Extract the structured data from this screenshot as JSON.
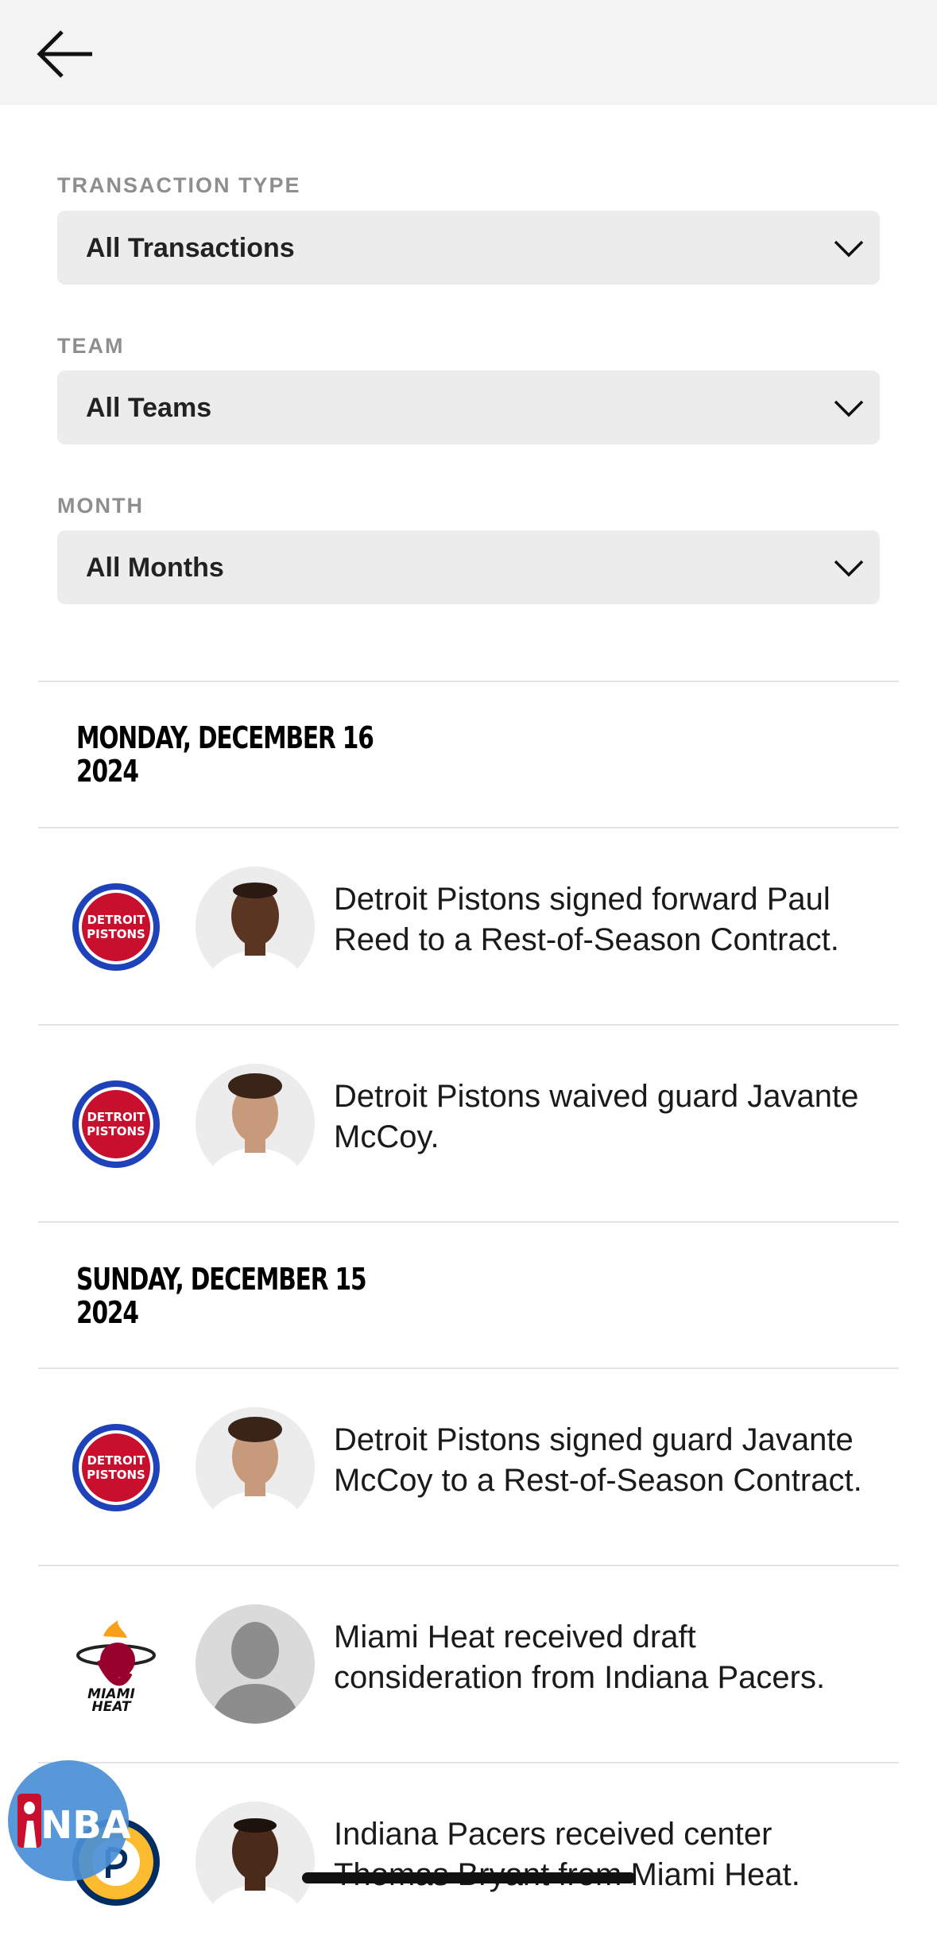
{
  "filters": [
    {
      "label": "TRANSACTION TYPE",
      "value": "All Transactions"
    },
    {
      "label": "TEAM",
      "value": "All Teams"
    },
    {
      "label": "MONTH",
      "value": "All Months"
    }
  ],
  "groups": [
    {
      "date_line1": "MONDAY, DECEMBER 16",
      "date_line2": "2024",
      "items": [
        {
          "team": "Detroit Pistons",
          "logo_text": "DETROIT PISTONS",
          "text": "Detroit Pistons signed forward Paul Reed to a Rest-of-Season Contract."
        },
        {
          "team": "Detroit Pistons",
          "logo_text": "DETROIT PISTONS",
          "text": "Detroit Pistons waived guard Javante McCoy."
        }
      ]
    },
    {
      "date_line1": "SUNDAY, DECEMBER 15",
      "date_line2": "2024",
      "items": [
        {
          "team": "Detroit Pistons",
          "logo_text": "DETROIT PISTONS",
          "text": "Detroit Pistons signed guard Javante McCoy to a Rest-of-Season Contract."
        },
        {
          "team": "Miami Heat",
          "logo_text": "MIAMI HEAT",
          "text": "Miami Heat received draft consideration from Indiana Pacers."
        },
        {
          "team": "Indiana Pacers",
          "logo_text": "PACERS",
          "text": "Indiana Pacers received center Thomas Bryant from Miami Heat."
        }
      ]
    }
  ],
  "fab": {
    "label": "NBA"
  },
  "colors": {
    "pistons_blue": "#1d42ba",
    "pistons_red": "#c8102e",
    "heat_red": "#98002e",
    "pacers_gold": "#fdbb30",
    "nba_blue": "#4a8fd6"
  }
}
